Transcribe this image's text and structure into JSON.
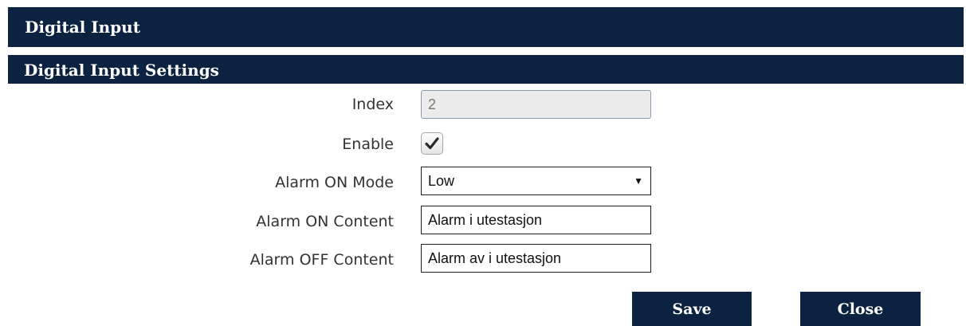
{
  "header": {
    "title": "Digital Input"
  },
  "section": {
    "title": "Digital Input Settings"
  },
  "form": {
    "index": {
      "label": "Index",
      "value": "2"
    },
    "enable": {
      "label": "Enable",
      "checked": true
    },
    "alarm_on_mode": {
      "label": "Alarm ON Mode",
      "value": "Low"
    },
    "alarm_on_content": {
      "label": "Alarm ON Content",
      "value": "Alarm i utestasjon"
    },
    "alarm_off_content": {
      "label": "Alarm OFF Content",
      "value": "Alarm av i utestasjon"
    }
  },
  "buttons": {
    "save_label": "Save",
    "close_label": "Close"
  },
  "colors": {
    "header_bg": "#0b2341",
    "button_bg": "#0b2341",
    "header_text": "#ffffff"
  },
  "icons": {
    "checkmark": "checkmark-icon",
    "dropdown": "dropdown-arrow-icon"
  }
}
